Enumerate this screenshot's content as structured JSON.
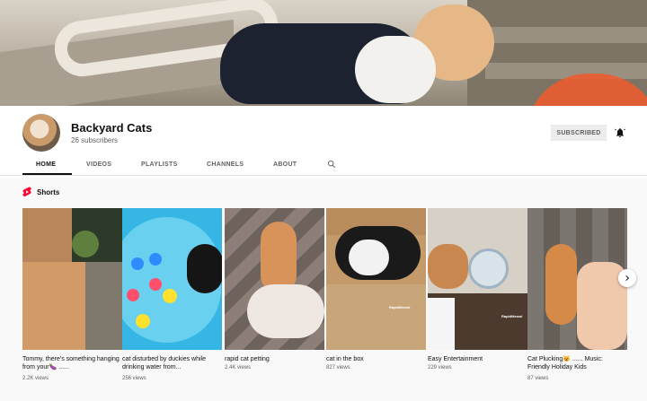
{
  "channel": {
    "name": "Backyard Cats",
    "subscribers": "26 subscribers",
    "subscribe_label": "SUBSCRIBED"
  },
  "tabs": [
    "HOME",
    "VIDEOS",
    "PLAYLISTS",
    "CHANNELS",
    "ABOUT"
  ],
  "active_tab": "HOME",
  "shorts": {
    "heading": "Shorts",
    "items": [
      {
        "title": "Tommy, there's something hanging from your🍆 ......",
        "views": "2.2K views"
      },
      {
        "title": "cat disturbed by duckies while drinking water from...",
        "views": "256 views"
      },
      {
        "title": "rapid cat petting",
        "views": "2.4K views"
      },
      {
        "title": "cat in the box",
        "views": "827 views"
      },
      {
        "title": "Easy Entertainment",
        "views": "229 views"
      },
      {
        "title": "Cat Plucking😺 ...... Music: Friendly Holiday Kids",
        "views": "87 views"
      }
    ],
    "overlay_label": "RapidMeowl"
  },
  "icons": {
    "bell": "bell-icon",
    "search": "search-icon",
    "shorts": "shorts-logo-icon",
    "next": "chevron-right-icon"
  },
  "colors": {
    "shorts_red": "#ff0033",
    "tab_active": "#0f0f0f",
    "muted": "#606060"
  }
}
